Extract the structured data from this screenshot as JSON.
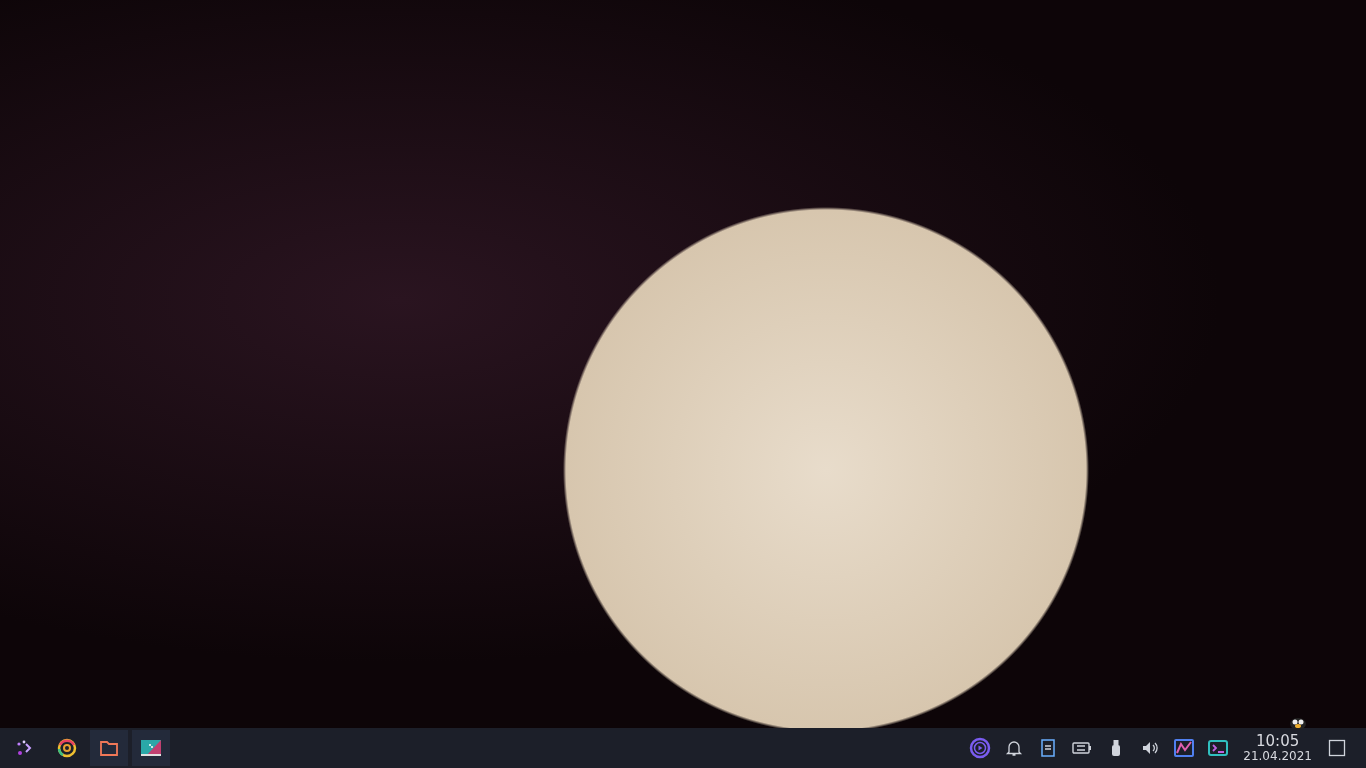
{
  "taskbar": {
    "launchers": [
      {
        "kind": "app-menu",
        "running": false
      },
      {
        "kind": "browser",
        "running": false
      },
      {
        "kind": "folder",
        "running": true
      },
      {
        "kind": "store",
        "running": true
      }
    ],
    "tray": [
      {
        "kind": "media"
      },
      {
        "kind": "bell"
      },
      {
        "kind": "notes"
      },
      {
        "kind": "battery"
      },
      {
        "kind": "usb"
      },
      {
        "kind": "volume"
      },
      {
        "kind": "monitor"
      },
      {
        "kind": "terminal"
      }
    ],
    "clock": {
      "time": "10:05",
      "date": "21.04.2021"
    }
  }
}
